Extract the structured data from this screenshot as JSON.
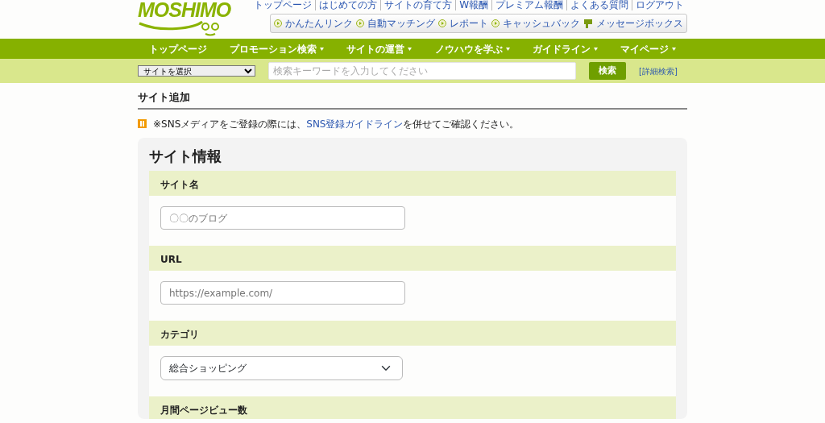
{
  "logo": {
    "text": "MOSHIMO"
  },
  "top_links": [
    "トップページ",
    "はじめての方",
    "サイトの育て方",
    "W報酬",
    "プレミアム報酬",
    "よくある質問",
    "ログアウト"
  ],
  "quick_links": [
    {
      "label": "かんたんリンク",
      "kind": "play"
    },
    {
      "label": "自動マッチング",
      "kind": "play"
    },
    {
      "label": "レポート",
      "kind": "play"
    },
    {
      "label": "キャッシュバック",
      "kind": "play"
    },
    {
      "label": "メッセージボックス",
      "kind": "message"
    }
  ],
  "nav": [
    {
      "label": "トップページ",
      "dropdown": false
    },
    {
      "label": "プロモーション検索",
      "dropdown": true
    },
    {
      "label": "サイトの運営",
      "dropdown": true
    },
    {
      "label": "ノウハウを学ぶ",
      "dropdown": true
    },
    {
      "label": "ガイドライン",
      "dropdown": true
    },
    {
      "label": "マイページ",
      "dropdown": true
    }
  ],
  "search": {
    "site_select": "サイトを選択",
    "placeholder": "検索キーワードを入力してください",
    "button": "検索",
    "advanced": "[詳細検索]"
  },
  "page_title": "サイト追加",
  "notice": {
    "before": "※SNSメディアをご登録の際には、",
    "link": "SNS登録ガイドライン",
    "after": "を併せてご確認ください。"
  },
  "form": {
    "title": "サイト情報",
    "fields": [
      {
        "label": "サイト名",
        "kind": "text",
        "placeholder": "〇〇のブログ"
      },
      {
        "label": "URL",
        "kind": "text",
        "placeholder": "https://example.com/"
      },
      {
        "label": "カテゴリ",
        "kind": "select",
        "value": "総合ショッピング"
      },
      {
        "label": "月間ページビュー数",
        "kind": "none"
      }
    ]
  }
}
